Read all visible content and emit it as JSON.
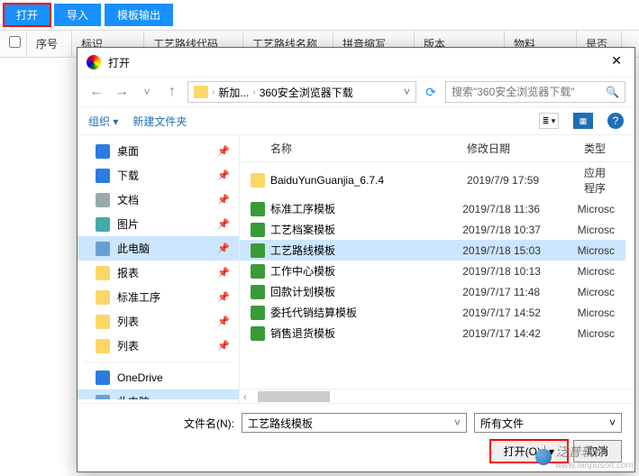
{
  "top_buttons": {
    "open": "打开",
    "import": "导入",
    "template_out": "模板输出"
  },
  "table_cols": [
    "序号",
    "标识",
    "工艺路线代码",
    "工艺路线名称",
    "拼音缩写",
    "版本",
    "物料",
    "是否"
  ],
  "dialog": {
    "title": "打开",
    "crumbs": [
      "新加...",
      "360安全浏览器下载"
    ],
    "search_placeholder": "搜索\"360安全浏览器下载\"",
    "toolbar": {
      "organize": "组织",
      "new_folder": "新建文件夹"
    },
    "sidebar": [
      {
        "label": "桌面",
        "pin": true,
        "color": "#2a7de1"
      },
      {
        "label": "下载",
        "pin": true,
        "color": "#2a7de1"
      },
      {
        "label": "文档",
        "pin": true,
        "color": "#9aa"
      },
      {
        "label": "图片",
        "pin": true,
        "color": "#4aa"
      },
      {
        "label": "此电脑",
        "pin": true,
        "color": "#6aa0d0",
        "selected": true
      },
      {
        "label": "报表",
        "pin": true,
        "color": "#fdd668"
      },
      {
        "label": "标准工序",
        "pin": true,
        "color": "#fdd668"
      },
      {
        "label": "列表",
        "pin": true,
        "color": "#fdd668"
      },
      {
        "label": "列表",
        "pin": true,
        "color": "#fdd668"
      }
    ],
    "sidebar2": [
      {
        "label": "OneDrive",
        "color": "#2a7de1"
      },
      {
        "label": "此电脑",
        "color": "#6aa0d0",
        "selected": true
      }
    ],
    "file_cols": {
      "name": "名称",
      "date": "修改日期",
      "type": "类型"
    },
    "files": [
      {
        "name": "BaiduYunGuanjia_6.7.4",
        "date": "2019/7/9 17:59",
        "type": "应用程序",
        "color": "#fdd668"
      },
      {
        "name": "标准工序模板",
        "date": "2019/7/18 11:36",
        "type": "Microsc",
        "color": "#3a9a3a"
      },
      {
        "name": "工艺档案模板",
        "date": "2019/7/18 10:37",
        "type": "Microsc",
        "color": "#3a9a3a"
      },
      {
        "name": "工艺路线模板",
        "date": "2019/7/18 15:03",
        "type": "Microsc",
        "color": "#3a9a3a",
        "selected": true
      },
      {
        "name": "工作中心模板",
        "date": "2019/7/18 10:13",
        "type": "Microsc",
        "color": "#3a9a3a"
      },
      {
        "name": "回款计划模板",
        "date": "2019/7/17 11:48",
        "type": "Microsc",
        "color": "#3a9a3a"
      },
      {
        "name": "委托代销结算模板",
        "date": "2019/7/17 14:52",
        "type": "Microsc",
        "color": "#3a9a3a"
      },
      {
        "name": "销售退货模板",
        "date": "2019/7/17 14:42",
        "type": "Microsc",
        "color": "#3a9a3a"
      }
    ],
    "footer": {
      "filename_label": "文件名(N):",
      "filename_value": "工艺路线模板",
      "filter_value": "所有文件",
      "open_btn": "打开(O)",
      "cancel_btn": "取消"
    }
  },
  "watermark": {
    "brand": "泛普软件",
    "url": "www.fanpusoft.com"
  }
}
